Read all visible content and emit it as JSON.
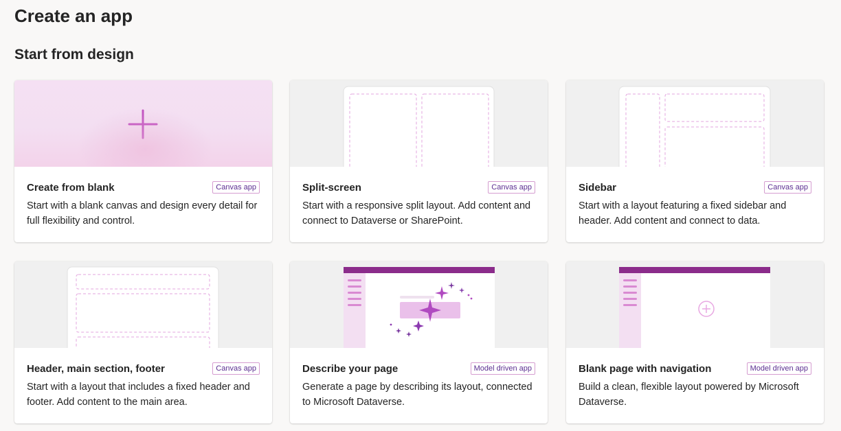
{
  "page": {
    "title": "Create an app",
    "section_title": "Start from design"
  },
  "colors": {
    "accent_purple": "#c050c0",
    "header_purple": "#8b2c8b",
    "sidebar_pink": "#f3dff2"
  },
  "cards": [
    {
      "title": "Create from blank",
      "badge": "Canvas app",
      "description": "Start with a blank canvas and design every detail for full flexibility and control.",
      "thumbnail_icon": "plus-icon"
    },
    {
      "title": "Split-screen",
      "badge": "Canvas app",
      "description": "Start with a responsive split layout. Add content and connect to Dataverse or SharePoint.",
      "thumbnail_icon": "split-screen-layout-icon"
    },
    {
      "title": "Sidebar",
      "badge": "Canvas app",
      "description": "Start with a layout featuring a fixed sidebar and header. Add content and connect to data.",
      "thumbnail_icon": "sidebar-layout-icon"
    },
    {
      "title": "Header, main section, footer",
      "badge": "Canvas app",
      "description": "Start with a layout that includes a fixed header and footer. Add content to the main area.",
      "thumbnail_icon": "header-main-footer-layout-icon"
    },
    {
      "title": "Describe your page",
      "badge": "Model driven app",
      "description": "Generate a page by describing its layout, connected to Microsoft Dataverse.",
      "thumbnail_icon": "sparkle-icon"
    },
    {
      "title": "Blank page with navigation",
      "badge": "Model driven app",
      "description": "Build a clean, flexible layout powered by Microsoft Dataverse.",
      "thumbnail_icon": "add-circle-icon"
    }
  ]
}
